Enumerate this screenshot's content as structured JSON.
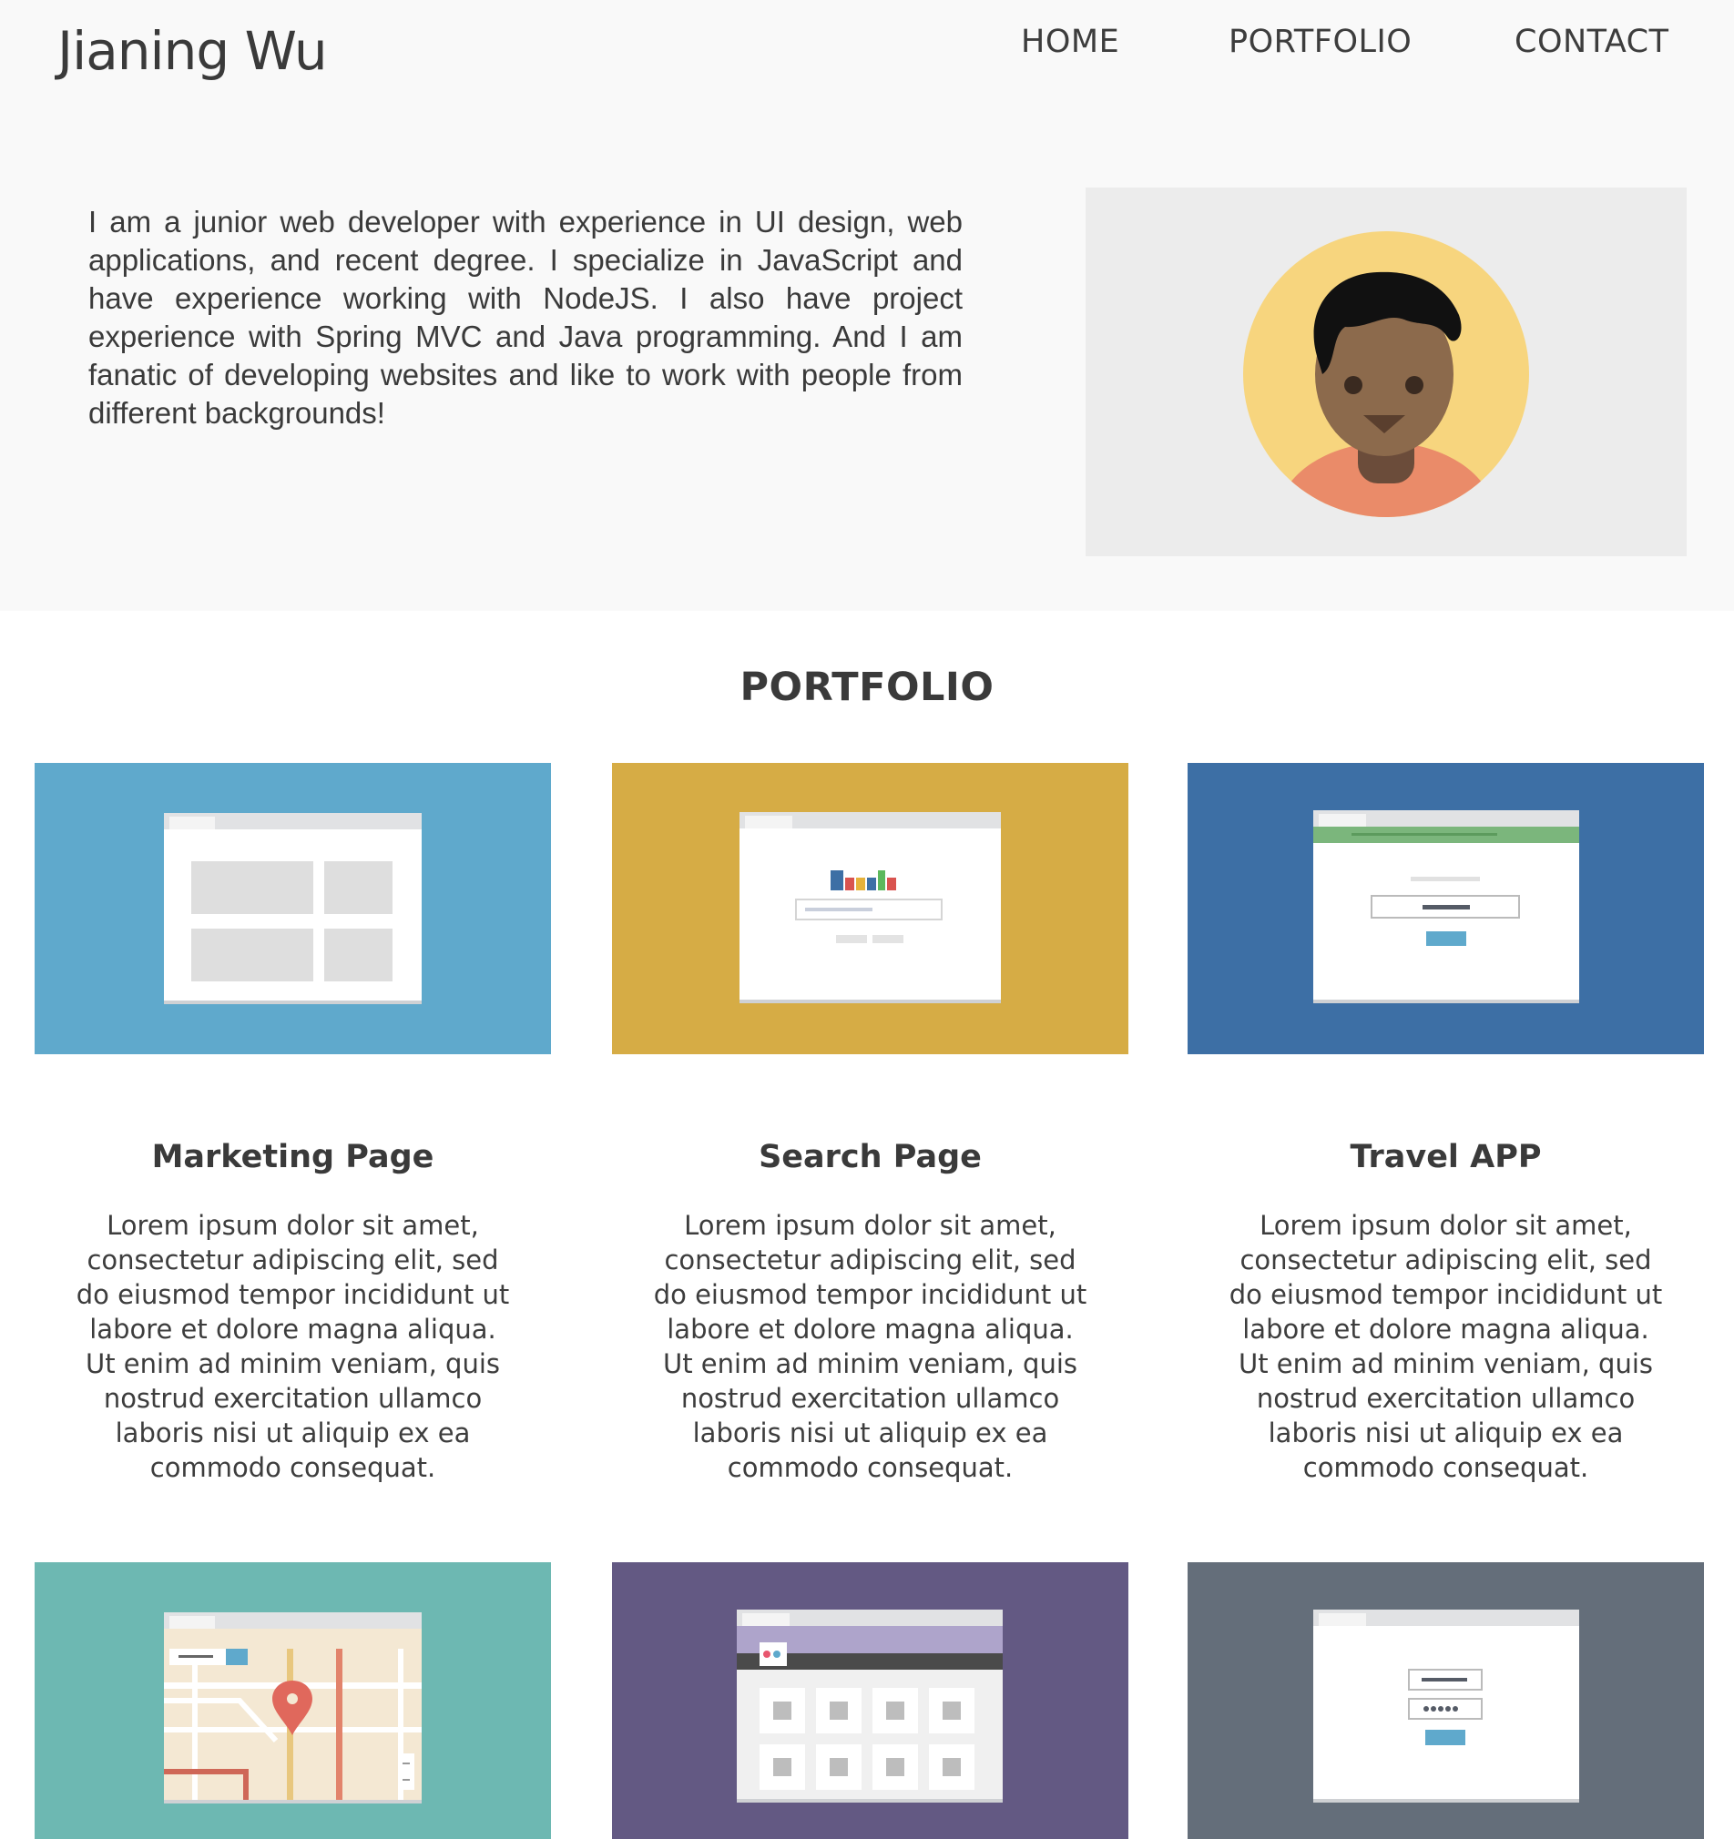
{
  "header": {
    "brand": "Jianing Wu",
    "nav": [
      "HOME",
      "PORTFOLIO",
      "CONTACT"
    ]
  },
  "intro": {
    "text": "I am a junior web developer with experience in UI design, web applications, and recent degree. I specialize in JavaScript and have experience working with NodeJS. I also have project experience with Spring MVC and Java programming. And I am fanatic of developing websites and like to work with people from different backgrounds!"
  },
  "portfolio": {
    "title": "PORTFOLIO",
    "cards": [
      {
        "title": "Marketing Page",
        "text": "Lorem ipsum dolor sit amet, consectetur adipiscing elit, sed do eiusmod tempor incididunt ut labore et dolore magna aliqua. Ut enim ad minim veniam, quis nostrud exercitation ullamco laboris nisi ut aliquip ex ea commodo consequat.",
        "color": "#5fa9cc",
        "icon": "browser-grid-illustration"
      },
      {
        "title": "Search Page",
        "text": "Lorem ipsum dolor sit amet, consectetur adipiscing elit, sed do eiusmod tempor incididunt ut labore et dolore magna aliqua. Ut enim ad minim veniam, quis nostrud exercitation ullamco laboris nisi ut aliquip ex ea commodo consequat.",
        "color": "#d6ac45",
        "icon": "search-page-illustration"
      },
      {
        "title": "Travel APP",
        "text": "Lorem ipsum dolor sit amet, consectetur adipiscing elit, sed do eiusmod tempor incididunt ut labore et dolore magna aliqua. Ut enim ad minim veniam, quis nostrud exercitation ullamco laboris nisi ut aliquip ex ea commodo consequat.",
        "color": "#3d6fa5",
        "icon": "form-page-illustration"
      }
    ],
    "tiles_row2": [
      {
        "color": "#6db8b2",
        "icon": "map-illustration"
      },
      {
        "color": "#635983",
        "icon": "gallery-illustration"
      },
      {
        "color": "#646e7a",
        "icon": "login-illustration"
      }
    ]
  }
}
